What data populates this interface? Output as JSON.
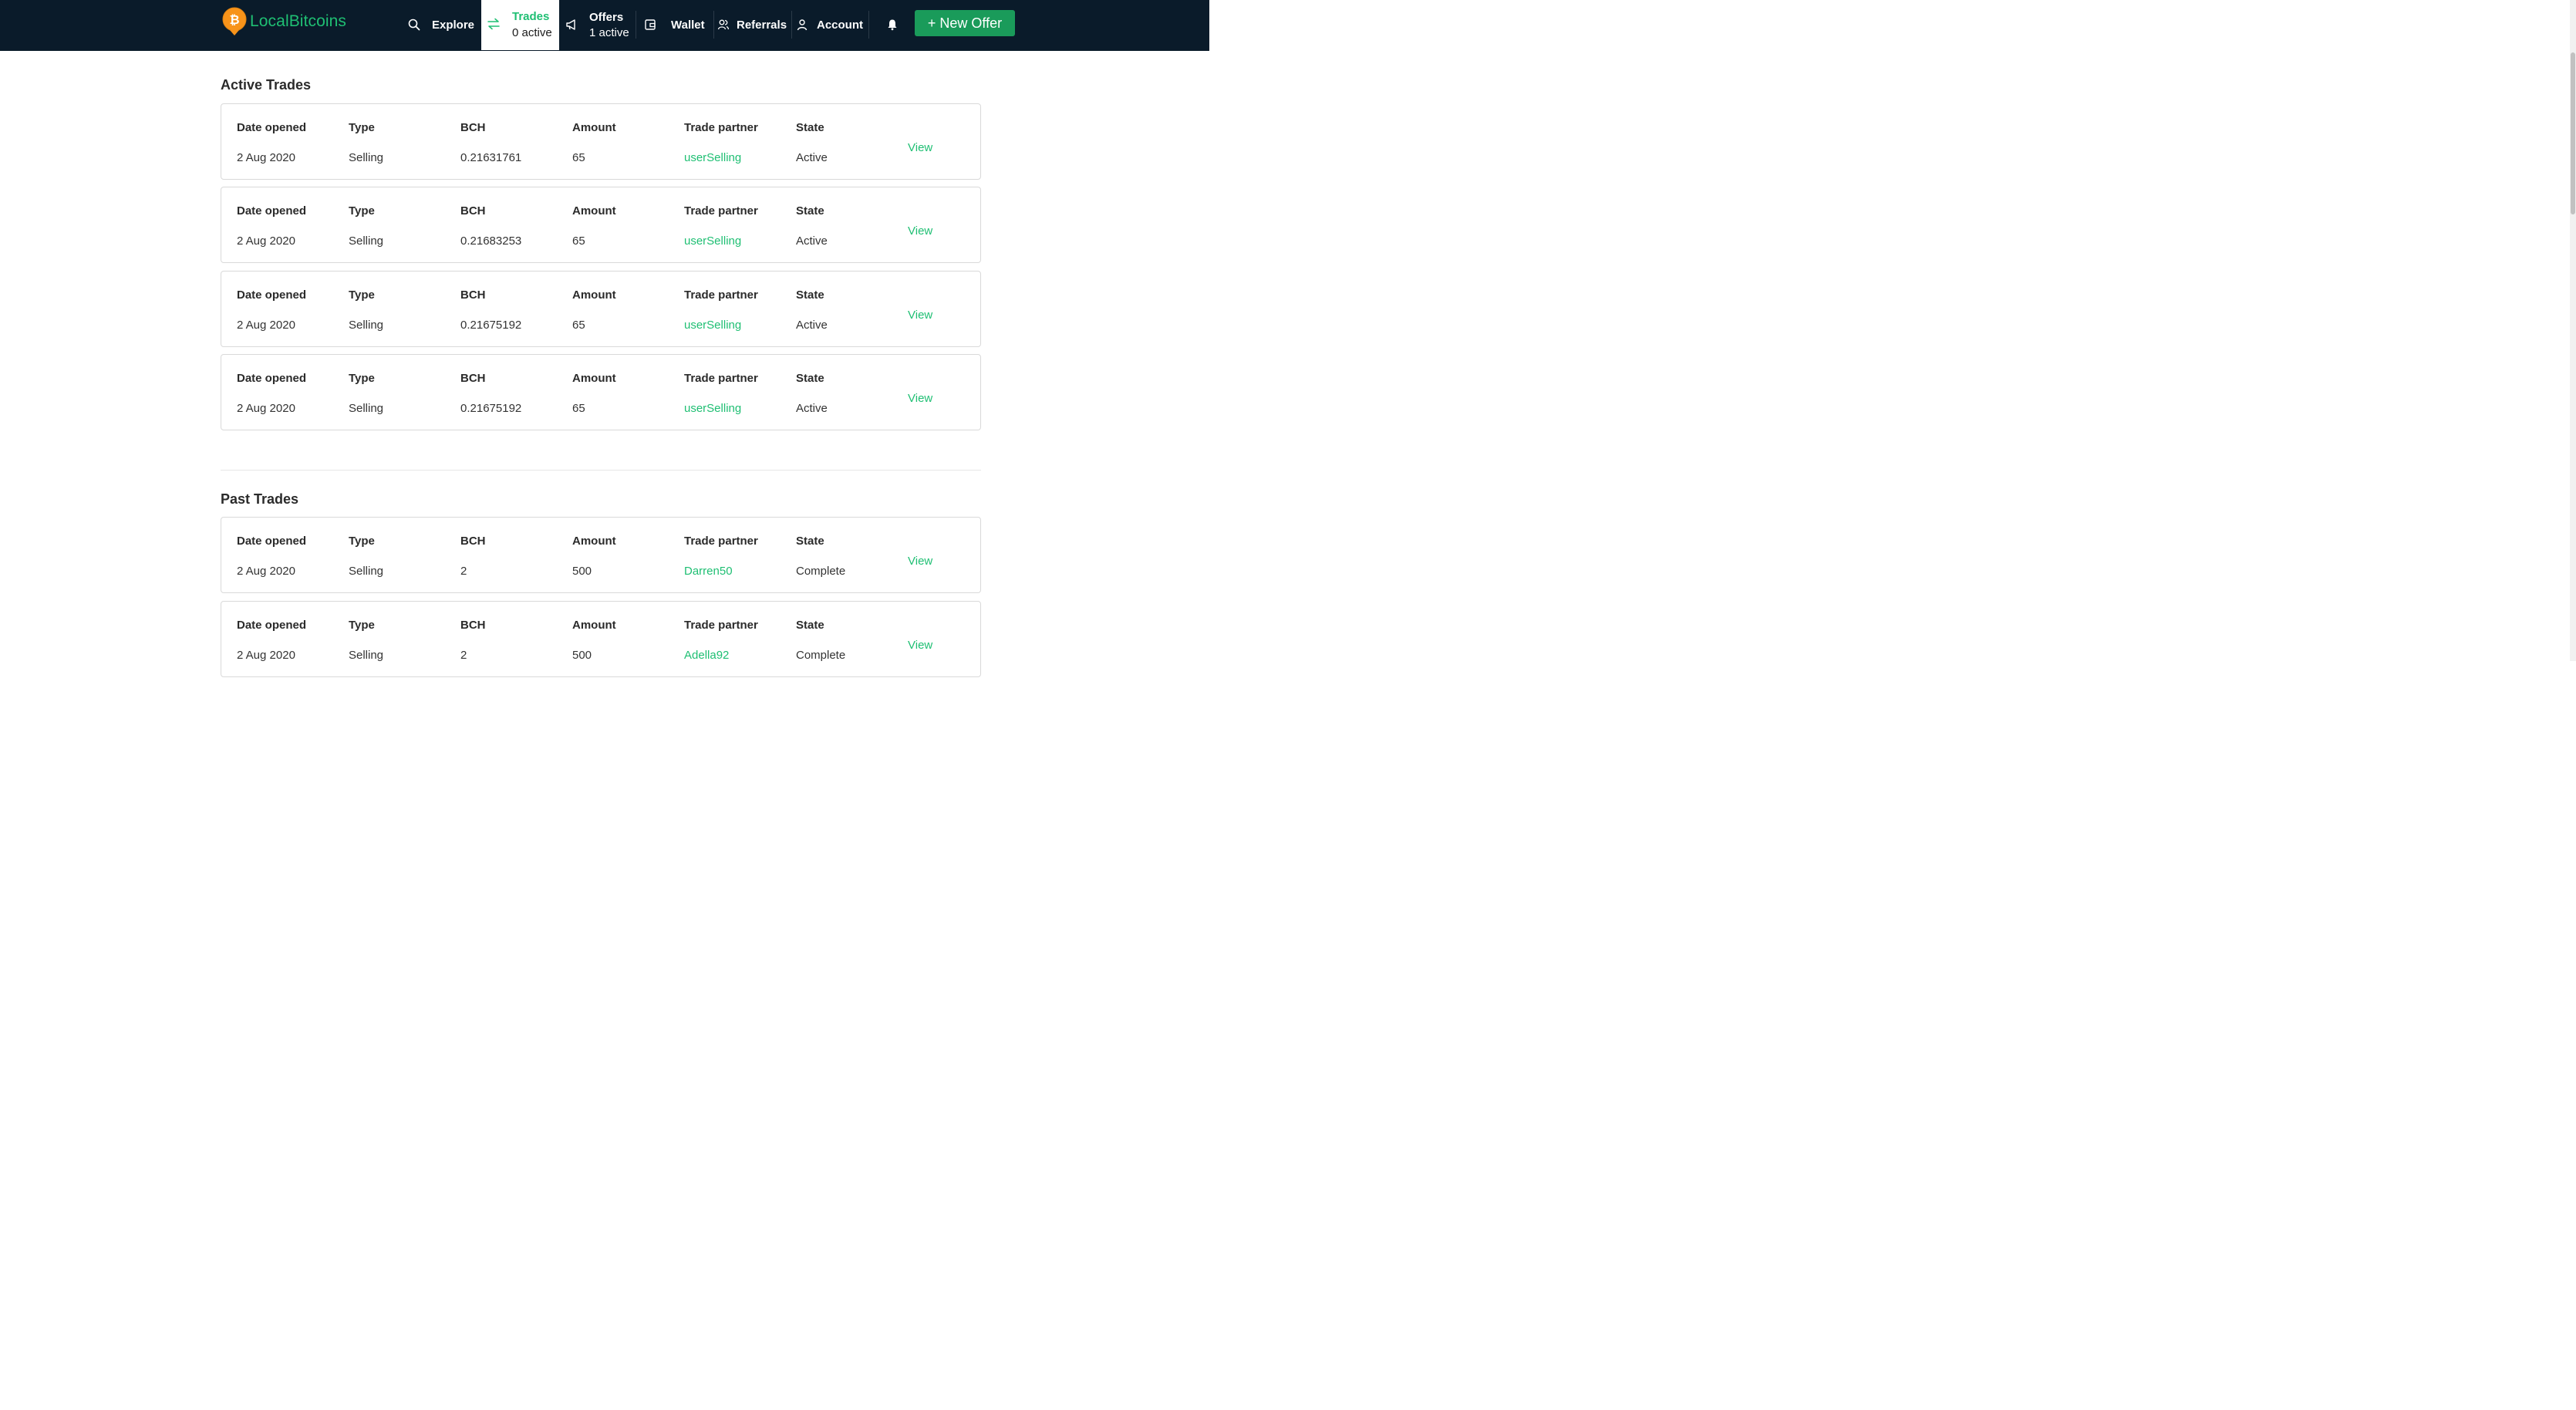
{
  "nav": {
    "brand": "LocalBitcoins",
    "explore": "Explore",
    "trades_label": "Trades",
    "trades_count": "0 active",
    "offers_label": "Offers",
    "offers_count": "1 active",
    "wallet": "Wallet",
    "referrals": "Referrals",
    "account": "Account",
    "new_offer": "+ New Offer"
  },
  "colors": {
    "nav_bg": "#0a1b2a",
    "accent": "#1fbf73",
    "button": "#1a9b5a",
    "logo_coin": "#f7931a"
  },
  "icons": [
    "search-icon",
    "swap-arrows-icon",
    "megaphone-icon",
    "wallet-icon",
    "referrals-icon",
    "account-icon",
    "bell-icon",
    "bitcoin-logo-icon"
  ],
  "columns": {
    "date": "Date opened",
    "type": "Type",
    "bch": "BCH",
    "amount": "Amount",
    "partner": "Trade partner",
    "state": "State",
    "view": "View"
  },
  "active": {
    "title": "Active Trades",
    "trades": [
      {
        "date": "2 Aug 2020",
        "type": "Selling",
        "bch": "0.21631761",
        "amount": "65",
        "partner": "userSelling",
        "state": "Active"
      },
      {
        "date": "2 Aug 2020",
        "type": "Selling",
        "bch": "0.21683253",
        "amount": "65",
        "partner": "userSelling",
        "state": "Active"
      },
      {
        "date": "2 Aug 2020",
        "type": "Selling",
        "bch": "0.21675192",
        "amount": "65",
        "partner": "userSelling",
        "state": "Active"
      },
      {
        "date": "2 Aug 2020",
        "type": "Selling",
        "bch": "0.21675192",
        "amount": "65",
        "partner": "userSelling",
        "state": "Active"
      }
    ]
  },
  "past": {
    "title": "Past Trades",
    "trades": [
      {
        "date": "2 Aug 2020",
        "type": "Selling",
        "bch": "2",
        "amount": "500",
        "partner": "Darren50",
        "state": "Complete"
      },
      {
        "date": "2 Aug 2020",
        "type": "Selling",
        "bch": "2",
        "amount": "500",
        "partner": "Adella92",
        "state": "Complete"
      }
    ]
  }
}
